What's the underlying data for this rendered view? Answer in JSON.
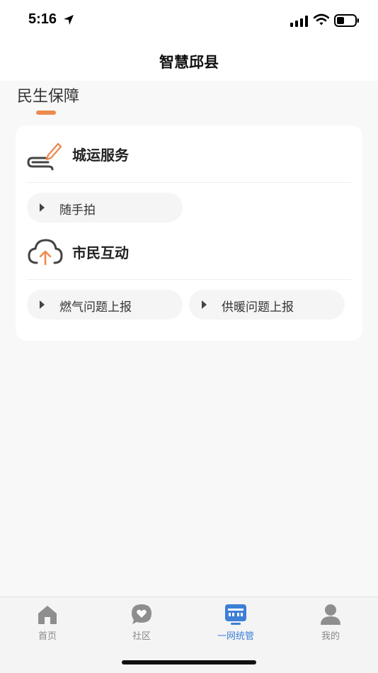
{
  "status_bar": {
    "time": "5:16"
  },
  "nav": {
    "title": "智慧邱县"
  },
  "section": {
    "title": "民生保障"
  },
  "groups": [
    {
      "label": "城运服务",
      "items": [
        "随手拍"
      ]
    },
    {
      "label": "市民互动",
      "items": [
        "燃气问题上报",
        "供暖问题上报"
      ]
    }
  ],
  "tabs": [
    {
      "label": "首页",
      "icon": "home-icon"
    },
    {
      "label": "社区",
      "icon": "heart-chat-icon"
    },
    {
      "label": "一网统管",
      "icon": "monitor-network-icon"
    },
    {
      "label": "我的",
      "icon": "person-icon"
    }
  ],
  "active_tab": "一网统管",
  "colors": {
    "accent": "#ee8a4f",
    "active_tab": "#3d7fd6",
    "inactive_tab": "#888888"
  }
}
